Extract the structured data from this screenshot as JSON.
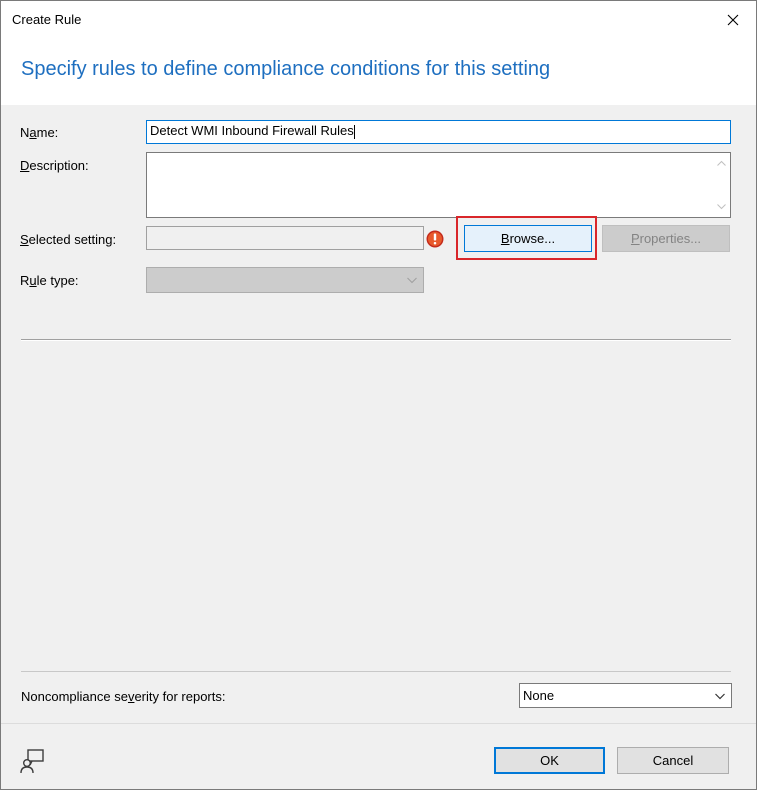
{
  "window": {
    "title": "Create Rule"
  },
  "header": {
    "title": "Specify rules to define compliance conditions for this setting"
  },
  "form": {
    "name_label_pre": "N",
    "name_label_ul": "a",
    "name_label_post": "me:",
    "name_value": "Detect WMI Inbound Firewall Rules",
    "description_label_ul": "D",
    "description_label_post": "escription:",
    "description_value": "",
    "selected_setting_label_ul": "S",
    "selected_setting_label_post": "elected setting:",
    "selected_setting_value": "",
    "browse_label_ul": "B",
    "browse_label_post": "rowse...",
    "properties_label_ul": "P",
    "properties_label_post": "roperties...",
    "rule_type_label_pre": "R",
    "rule_type_label_ul": "u",
    "rule_type_label_post": "le type:",
    "rule_type_value": ""
  },
  "severity": {
    "label_pre": "Noncompliance se",
    "label_ul": "v",
    "label_post": "erity for reports:",
    "value": "None"
  },
  "buttons": {
    "ok": "OK",
    "cancel": "Cancel"
  },
  "colors": {
    "accent": "#1e6fc0",
    "highlight": "#d9262a",
    "error": "#c42b1c",
    "focus": "#0078d7"
  },
  "icons": [
    "close-icon",
    "scroll-up-icon",
    "scroll-down-icon",
    "error-icon",
    "chevron-down-icon",
    "help-user-icon"
  ]
}
